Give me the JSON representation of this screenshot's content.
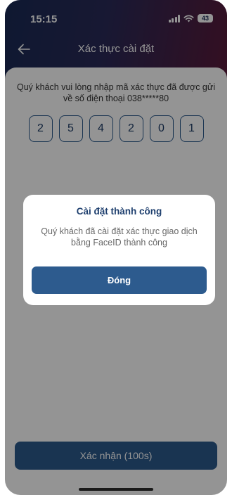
{
  "status_bar": {
    "time": "15:15",
    "battery": "43",
    "signal_icon": "signal-icon",
    "wifi_icon": "wifi-icon"
  },
  "nav": {
    "title": "Xác thực cài đặt",
    "back_icon": "back-arrow-icon"
  },
  "otp": {
    "instruction": "Quý khách vui lòng nhập mã xác thực đã được gửi về số điện thoại 038*****80",
    "digits": [
      "2",
      "5",
      "4",
      "2",
      "0",
      "1"
    ]
  },
  "confirm_button": {
    "label": "Xác nhận (100s)"
  },
  "dialog": {
    "title": "Cài đặt thành công",
    "message": "Quý khách đã cài đặt xác thực giao dịch bằng FaceID thành công",
    "button_label": "Đóng"
  },
  "colors": {
    "primary": "#2c5a8c",
    "title": "#1e3f6e",
    "header_start": "#1a2a55",
    "header_end": "#5a1a3a"
  }
}
